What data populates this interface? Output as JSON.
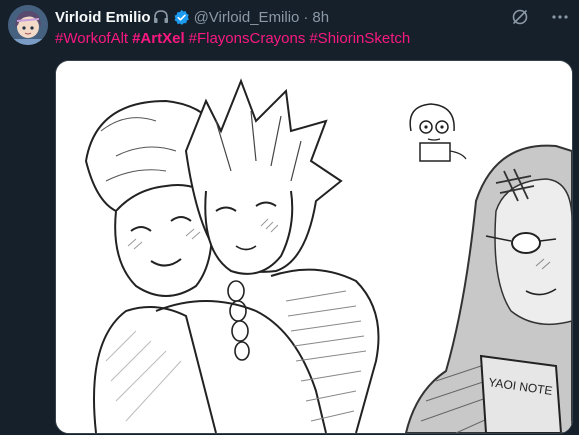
{
  "tweet": {
    "display_name": "Virloid Emilio",
    "handle": "@Virloid_Emilio",
    "separator": "·",
    "time": "8h",
    "hashtags": [
      {
        "text": "#WorkofAlt",
        "bold": false
      },
      {
        "text": "#ArtXel",
        "bold": true
      },
      {
        "text": "#FlayonsCrayons",
        "bold": false
      },
      {
        "text": "#ShiorinSketch",
        "bold": false
      }
    ],
    "image": {
      "book_text": "YAOI NOTE"
    }
  },
  "icons": {
    "name_emoji": "headphones-icon",
    "verified": "verified-badge-icon",
    "grok": "grok-icon",
    "more": "more-dots-icon"
  },
  "colors": {
    "background": "#15202b",
    "name_text": "#f7f9f9",
    "secondary_text": "#8b98a5",
    "hashtag": "#f91880",
    "verified": "#1d9bf0",
    "media_border": "#38444d"
  }
}
